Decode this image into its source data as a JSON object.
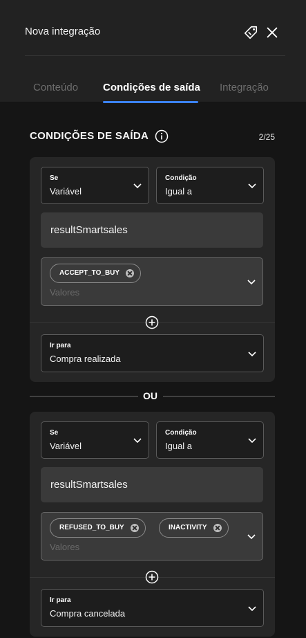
{
  "header": {
    "title": "Nova integração"
  },
  "tabs": [
    {
      "label": "Conteúdo"
    },
    {
      "label": "Condições de saída"
    },
    {
      "label": "Integração"
    }
  ],
  "section": {
    "title": "CONDIÇÕES DE SAÍDA",
    "counter": "2/25"
  },
  "or_label": "OU",
  "conditions": [
    {
      "se_label": "Se",
      "se_value": "Variável",
      "condicao_label": "Condição",
      "condicao_value": "Igual a",
      "variable": "resultSmartsales",
      "tags": [
        "ACCEPT_TO_BUY"
      ],
      "values_placeholder": "Valores",
      "goto_label": "Ir para",
      "goto_value": "Compra realizada"
    },
    {
      "se_label": "Se",
      "se_value": "Variável",
      "condicao_label": "Condição",
      "condicao_value": "Igual a",
      "variable": "resultSmartsales",
      "tags": [
        "REFUSED_TO_BUY",
        "INACTIVITY"
      ],
      "values_placeholder": "Valores",
      "goto_label": "Ir para",
      "goto_value": "Compra cancelada"
    }
  ],
  "colors": {
    "accent": "#3b82f6",
    "card": "#262626",
    "header": "#222222",
    "background": "#151515"
  },
  "icons": [
    "tag-icon",
    "close-icon",
    "info-icon",
    "chevron-down-icon",
    "add-circle-icon",
    "tag-remove-icon"
  ]
}
